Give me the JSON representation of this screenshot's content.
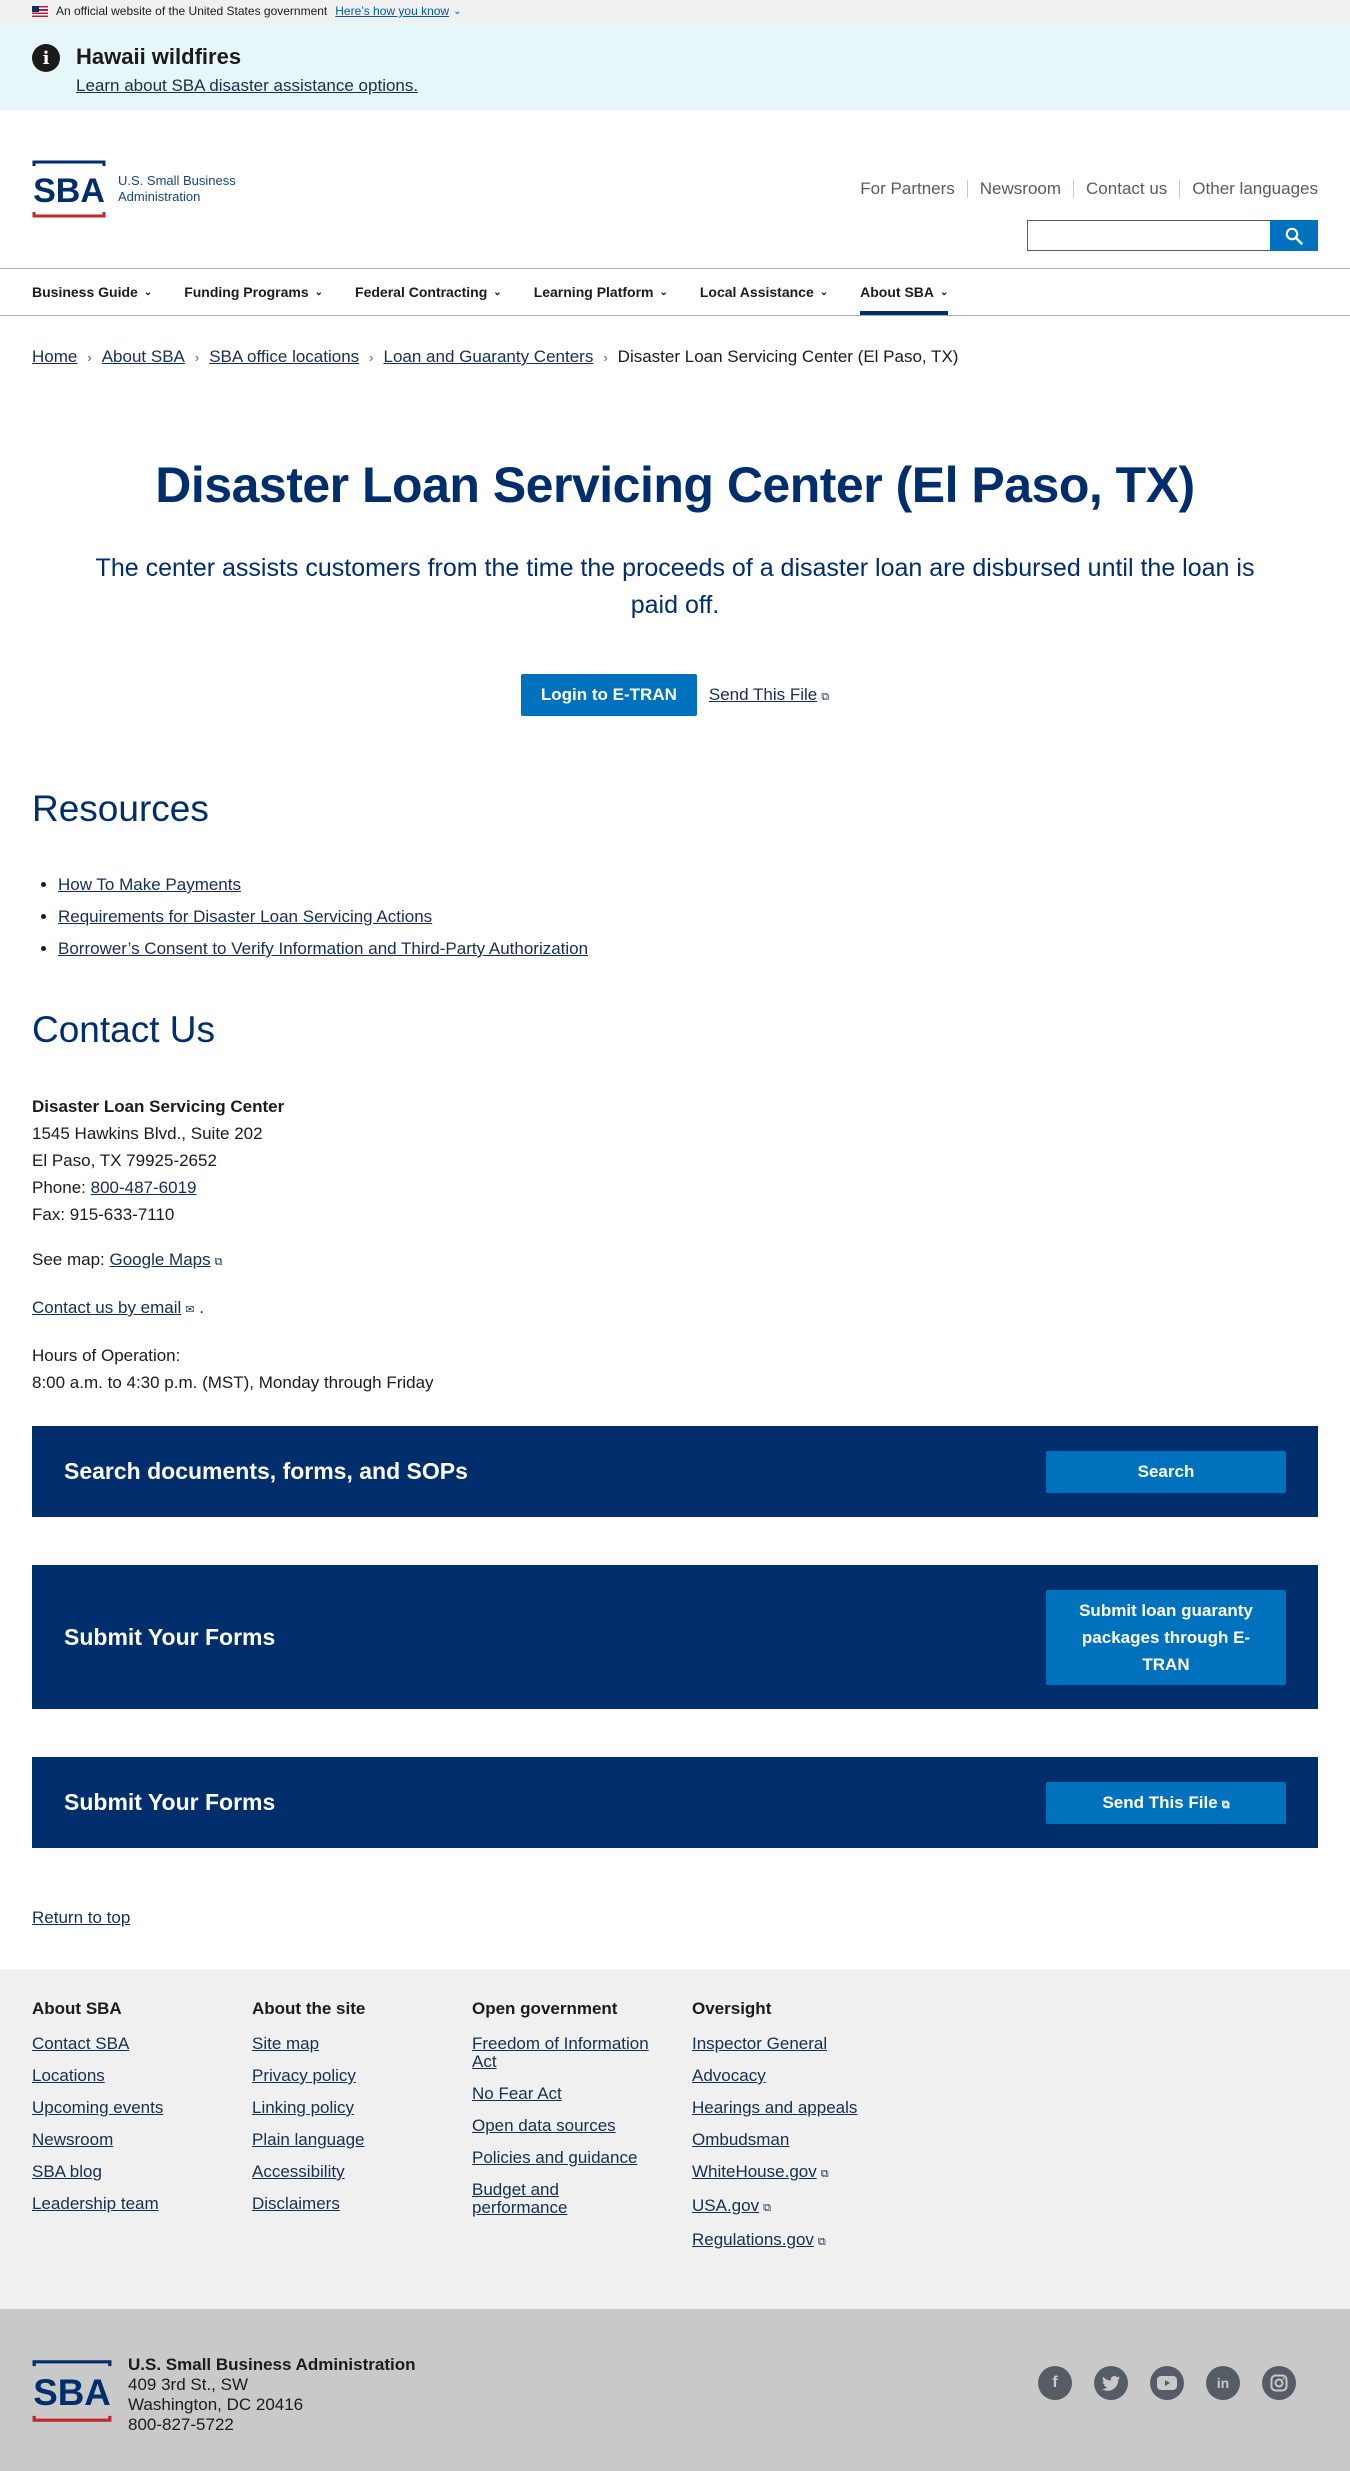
{
  "gov_banner": {
    "text": "An official website of the United States government",
    "link": "Here’s how you know"
  },
  "alert": {
    "title": "Hawaii wildfires",
    "link": "Learn about SBA disaster assistance options."
  },
  "header": {
    "logo_text_1": "U.S. Small Business",
    "logo_text_2": "Administration",
    "util_nav": [
      "For Partners",
      "Newsroom",
      "Contact us",
      "Other languages"
    ],
    "search_placeholder": ""
  },
  "nav": [
    "Business Guide",
    "Funding Programs",
    "Federal Contracting",
    "Learning Platform",
    "Local Assistance",
    "About SBA"
  ],
  "breadcrumb": [
    "Home",
    "About SBA",
    "SBA office locations",
    "Loan and Guaranty Centers"
  ],
  "breadcrumb_current": "Disaster Loan Servicing Center (El Paso, TX)",
  "hero": {
    "title": "Disaster Loan Servicing Center (El Paso, TX)",
    "subtitle": "The center assists customers from the time the proceeds of a disaster loan are disbursed until the loan is paid off.",
    "primary_button": "Login to E-TRAN",
    "secondary_link": "Send This File"
  },
  "resources": {
    "heading": "Resources",
    "items": [
      "How To Make Payments",
      "Requirements for Disaster Loan Servicing Actions",
      "Borrower’s Consent to Verify Information and Third-Party Authorization"
    ]
  },
  "contact": {
    "heading": "Contact Us",
    "name": "Disaster Loan Servicing Center",
    "address1": "1545 Hawkins Blvd., Suite 202",
    "address2": "El Paso, TX 79925-2652",
    "phone_label": "Phone:",
    "phone": "800-487-6019",
    "fax": "Fax: 915-633-7110",
    "map_label": "See map:",
    "map_link": "Google Maps",
    "email_link": "Contact us by email",
    "hours_label": "Hours of Operation:",
    "hours": "8:00 a.m. to 4:30 p.m. (MST), Monday through Friday"
  },
  "cards": [
    {
      "title": "Search documents, forms, and SOPs",
      "button": "Search"
    },
    {
      "title": "Submit Your Forms",
      "button": "Submit loan guaranty packages through E-TRAN"
    },
    {
      "title": "Submit Your Forms",
      "button": "Send This File"
    }
  ],
  "return_top": "Return to top",
  "footer": {
    "about_sba": {
      "title": "About SBA",
      "links": [
        "Contact SBA",
        "Locations",
        "Upcoming events",
        "Newsroom",
        "SBA blog",
        "Leadership team"
      ]
    },
    "about_site": {
      "title": "About the site",
      "links": [
        "Site map",
        "Privacy policy",
        "Linking policy",
        "Plain language",
        "Accessibility",
        "Disclaimers"
      ]
    },
    "open_gov": {
      "title": "Open government",
      "links": [
        "Freedom of Information Act",
        "No Fear Act",
        "Open data sources",
        "Policies and guidance",
        "Budget and performance"
      ]
    },
    "oversight": {
      "title": "Oversight",
      "links": [
        "Inspector General",
        "Advocacy",
        "Hearings and appeals",
        "Ombudsman",
        "WhiteHouse.gov",
        "USA.gov",
        "Regulations.gov"
      ]
    }
  },
  "bottom": {
    "org": "U.S. Small Business Administration",
    "addr1": "409 3rd St., SW",
    "addr2": "Washington, DC 20416",
    "phone": "800-827-5722",
    "socials": [
      "facebook-icon",
      "twitter-icon",
      "youtube-icon",
      "linkedin-icon",
      "instagram-icon"
    ]
  },
  "colors": {
    "navy": "#002e6d",
    "primary": "#0071bc",
    "alert_bg": "#e7f6f8",
    "footer_bg": "#f0f0f0",
    "bottom_bg": "#c9c9c9"
  }
}
